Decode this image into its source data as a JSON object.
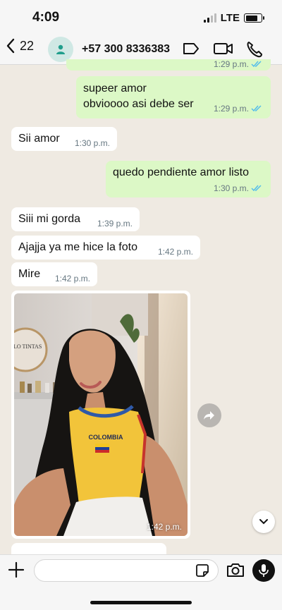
{
  "status": {
    "time": "4:09",
    "network": "LTE",
    "battery_level": 0.8
  },
  "header": {
    "back_count": "22",
    "contact": "+57 300 8336383"
  },
  "messages": [
    {
      "direction": "out",
      "text": "",
      "time": "1:29 p.m."
    },
    {
      "direction": "out",
      "text_line1": "supeer amor",
      "text_line2": "obvioooo asi debe ser",
      "time": "1:29 p.m."
    },
    {
      "direction": "in",
      "text": "Sii amor",
      "time": "1:30 p.m."
    },
    {
      "direction": "out",
      "text": "quedo pendiente amor listo",
      "time": "1:30 p.m."
    },
    {
      "direction": "in",
      "text": "Siii mi gorda",
      "time": "1:39 p.m."
    },
    {
      "direction": "in",
      "text": "Ajajja ya me hice la foto",
      "time": "1:42 p.m."
    },
    {
      "direction": "in",
      "text": "Mire",
      "time": "1:42 p.m."
    },
    {
      "direction": "in",
      "type": "photo",
      "time": "1:42 p.m.",
      "photo_signs": {
        "mirror": "SOLO TINTAS",
        "shirt": "COLOMBIA"
      }
    }
  ],
  "colors": {
    "outgoing": "#dcf8c6",
    "incoming": "#ffffff",
    "read_ticks": "#53bdeb",
    "background": "#efeae2"
  },
  "input": {
    "placeholder": "",
    "value": ""
  },
  "icons": [
    "chevron-left-icon",
    "person-icon",
    "label-icon",
    "video-icon",
    "phone-icon",
    "forward-icon",
    "chevron-down-icon",
    "plus-icon",
    "sticker-icon",
    "camera-icon",
    "mic-icon"
  ]
}
